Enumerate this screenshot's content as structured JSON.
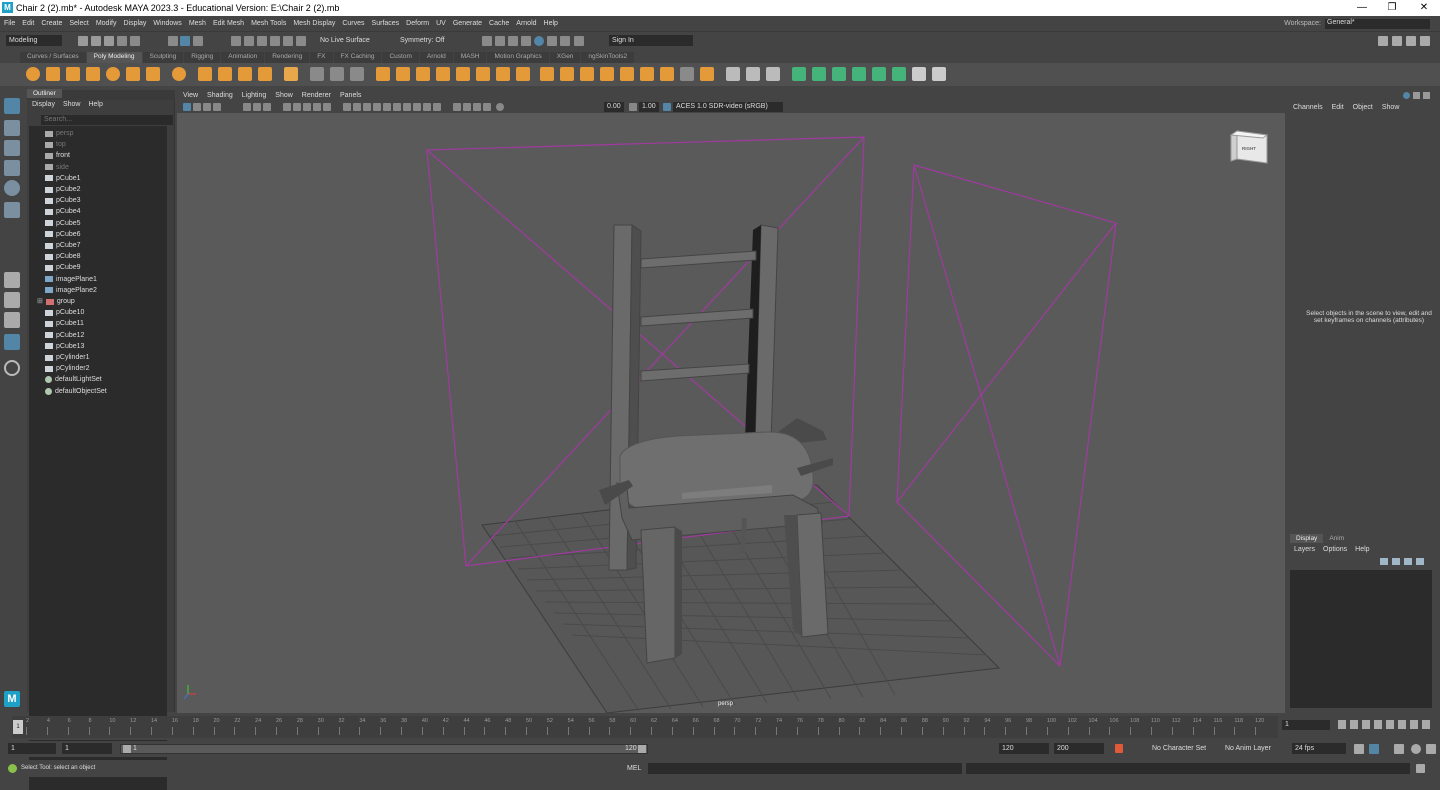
{
  "window": {
    "title": "Chair 2 (2).mb* - Autodesk MAYA 2023.3 - Educational Version: E:\\Chair 2 (2).mb",
    "min": "—",
    "max": "❐",
    "close": "✕"
  },
  "menubar": [
    "File",
    "Edit",
    "Create",
    "Select",
    "Modify",
    "Display",
    "Windows",
    "Mesh",
    "Edit Mesh",
    "Mesh Tools",
    "Mesh Display",
    "Curves",
    "Surfaces",
    "Deform",
    "UV",
    "Generate",
    "Cache",
    "Arnold",
    "Help"
  ],
  "workspace": {
    "label": "Workspace:",
    "value": "General*"
  },
  "statusline": {
    "mode": "Modeling",
    "live_surface": "No Live Surface",
    "symmetry": "Symmetry: Off",
    "sign_in": "Sign In"
  },
  "shelf_tabs": [
    "Curves / Surfaces",
    "Poly Modeling",
    "Sculpting",
    "Rigging",
    "Animation",
    "Rendering",
    "FX",
    "FX Caching",
    "Custom",
    "Arnold",
    "MASH",
    "Motion Graphics",
    "XGen",
    "ngSkinTools2"
  ],
  "shelf_active": "Poly Modeling",
  "outliner": {
    "tab": "Outliner",
    "menu": [
      "Display",
      "Show",
      "Help"
    ],
    "search_placeholder": "Search...",
    "items": [
      {
        "label": "persp",
        "dim": true,
        "icon": "camera"
      },
      {
        "label": "top",
        "dim": true,
        "icon": "camera"
      },
      {
        "label": "front",
        "dim": false,
        "icon": "camera"
      },
      {
        "label": "side",
        "dim": true,
        "icon": "camera"
      },
      {
        "label": "pCube1",
        "dim": false,
        "icon": "mesh"
      },
      {
        "label": "pCube2",
        "dim": false,
        "icon": "mesh"
      },
      {
        "label": "pCube3",
        "dim": false,
        "icon": "mesh"
      },
      {
        "label": "pCube4",
        "dim": false,
        "icon": "mesh"
      },
      {
        "label": "pCube5",
        "dim": false,
        "icon": "mesh"
      },
      {
        "label": "pCube6",
        "dim": false,
        "icon": "mesh"
      },
      {
        "label": "pCube7",
        "dim": false,
        "icon": "mesh"
      },
      {
        "label": "pCube8",
        "dim": false,
        "icon": "mesh"
      },
      {
        "label": "pCube9",
        "dim": false,
        "icon": "mesh"
      },
      {
        "label": "imagePlane1",
        "dim": false,
        "icon": "imageplane"
      },
      {
        "label": "imagePlane2",
        "dim": false,
        "icon": "imageplane"
      },
      {
        "label": "group",
        "dim": false,
        "icon": "group"
      },
      {
        "label": "pCube10",
        "dim": false,
        "icon": "mesh"
      },
      {
        "label": "pCube11",
        "dim": false,
        "icon": "mesh"
      },
      {
        "label": "pCube12",
        "dim": false,
        "icon": "mesh"
      },
      {
        "label": "pCube13",
        "dim": false,
        "icon": "mesh"
      },
      {
        "label": "pCylinder1",
        "dim": false,
        "icon": "mesh"
      },
      {
        "label": "pCylinder2",
        "dim": false,
        "icon": "mesh"
      },
      {
        "label": "defaultLightSet",
        "dim": false,
        "icon": "set"
      },
      {
        "label": "defaultObjectSet",
        "dim": false,
        "icon": "set"
      }
    ]
  },
  "viewport": {
    "menu": [
      "View",
      "Shading",
      "Lighting",
      "Show",
      "Renderer",
      "Panels"
    ],
    "value1": "0.00",
    "value2": "1.00",
    "colorspace": "ACES 1.0 SDR-video (sRGB)",
    "camera_label": "persp",
    "viewcube_label": "RIGHT"
  },
  "channels": {
    "menu": [
      "Channels",
      "Edit",
      "Object",
      "Show"
    ],
    "message": "Select objects in the scene to view, edit and set keyframes on channels (attributes)"
  },
  "layers": {
    "tabs": [
      "Display",
      "Anim"
    ],
    "menu": [
      "Layers",
      "Options",
      "Help"
    ]
  },
  "timeline": {
    "ticks": [
      "2",
      "4",
      "6",
      "8",
      "10",
      "12",
      "14",
      "16",
      "18",
      "20",
      "22",
      "24",
      "26",
      "28",
      "30",
      "32",
      "34",
      "36",
      "38",
      "40",
      "42",
      "44",
      "46",
      "48",
      "50",
      "52",
      "54",
      "56",
      "58",
      "60",
      "62",
      "64",
      "66",
      "68",
      "70",
      "72",
      "74",
      "76",
      "78",
      "80",
      "82",
      "84",
      "86",
      "88",
      "90",
      "92",
      "94",
      "96",
      "98",
      "100",
      "102",
      "104",
      "106",
      "108",
      "110",
      "112",
      "114",
      "116",
      "118",
      "120"
    ],
    "current_frame_field": "1",
    "current_frame_marker": "1"
  },
  "range": {
    "start": "1",
    "playback_start": "1",
    "slider_start": "1",
    "slider_end": "120",
    "playback_end": "120",
    "end": "200",
    "character_set": "No Character Set",
    "anim_layer": "No Anim Layer",
    "fps": "24 fps"
  },
  "cmdline": {
    "help": "Select Tool: select an object",
    "lang": "MEL"
  },
  "colors": {
    "accent": "#5285a6",
    "wireframe": "#a03aa0",
    "shelf_icon": "#e59a3a"
  }
}
